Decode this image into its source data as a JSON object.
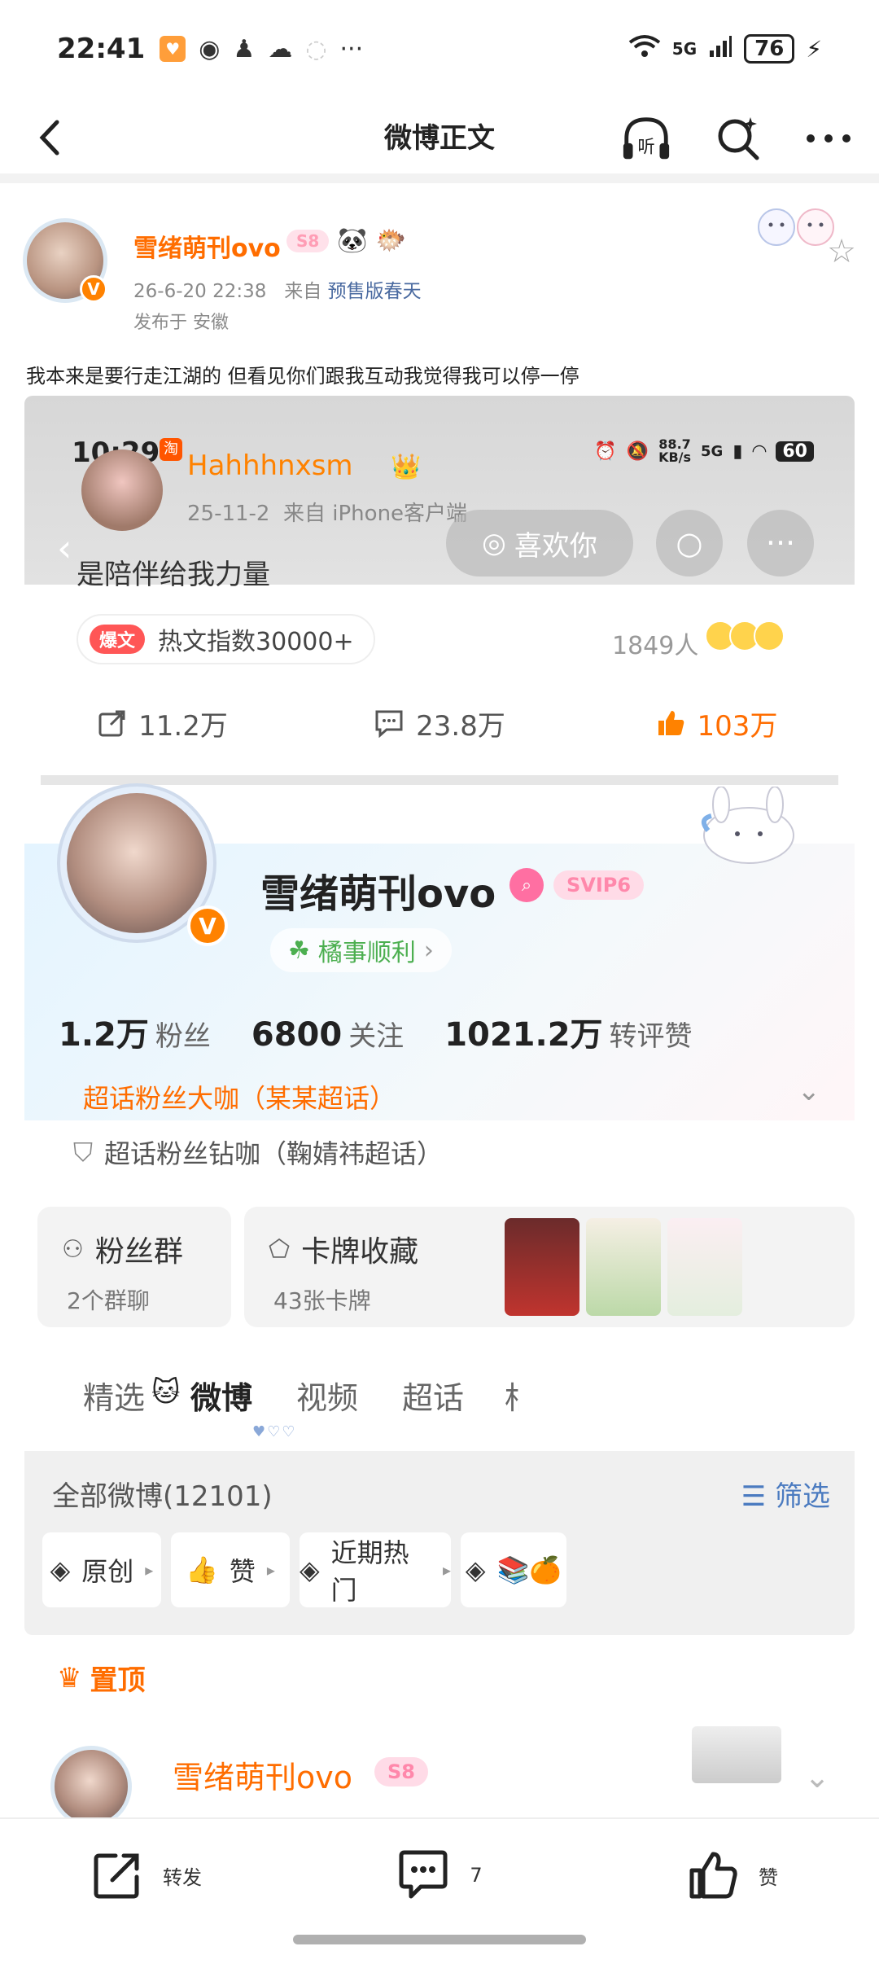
{
  "status_bar": {
    "time": "22:41",
    "network": "5G",
    "battery": "76"
  },
  "nav": {
    "title": "微博正文",
    "listen_label": "听"
  },
  "post": {
    "author": "雪绪萌刊ovo",
    "vip_badge": "S8",
    "date": "26-6-20 22:38",
    "source_prefix": "来自",
    "source": "预售版春天",
    "location": "发布于 安徽",
    "text": "我本来是要行走江湖的 但看见你们跟我互动我觉得我可以停一停"
  },
  "screenshot": {
    "status_time": "10:29",
    "taobao": "淘",
    "speed": "88.7",
    "speed_unit": "KB/s",
    "network": "5G",
    "battery": "60",
    "orig_author": "Hahhhnxsm",
    "orig_date": "25-11-2",
    "orig_source": "来自 iPhone客户端",
    "like_you": "喜欢你",
    "orig_text": "是陪伴给我力量",
    "hot_tag": "爆文",
    "hot_index": "热文指数30000+",
    "people_count": "1849人",
    "reposts": "11.2万",
    "comments": "23.8万",
    "likes": "103万",
    "profile": {
      "name": "雪绪萌刊ovo",
      "svip": "SVIP6",
      "v_badge": "V",
      "status": "橘事顺利",
      "fans": "1.2万",
      "fans_label": "粉丝",
      "follow": "6800",
      "follow_label": "关注",
      "interactions": "1021.2万",
      "interactions_label": "转评赞",
      "super_fan_big": "超话粉丝大咖（某某超话）",
      "super_fan_diamond": "超话粉丝钻咖（鞠婧祎超话）"
    },
    "cards": {
      "fan_group_title": "粉丝群",
      "fan_group_sub": "2个群聊",
      "card_collect_title": "卡牌收藏",
      "card_collect_sub": "43张卡牌"
    },
    "tabs": [
      "精选",
      "微博",
      "视频",
      "超话",
      "相"
    ],
    "all_weibo": "全部微博(12101)",
    "filter": "筛选",
    "chips": [
      "原创",
      "赞",
      "近期热门",
      "📚🍊"
    ],
    "pinned": "置顶"
  },
  "next_item": {
    "author": "雪绪萌刊ovo",
    "vip_badge": "S8"
  },
  "action_bar": {
    "repost": "转发",
    "comment_count": "7",
    "like": "赞"
  },
  "colors": {
    "accent": "#ff6d00",
    "link": "#4a6aa0"
  }
}
